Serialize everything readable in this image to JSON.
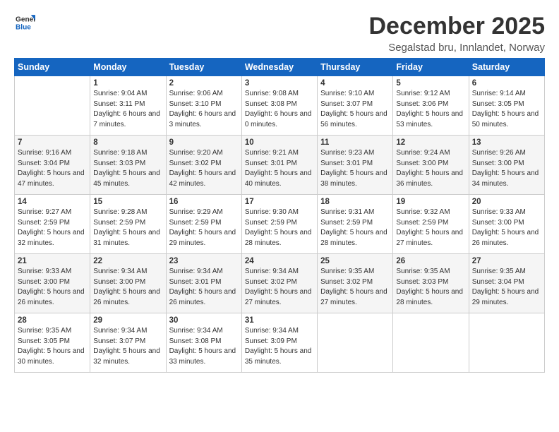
{
  "logo": {
    "line1": "General",
    "line2": "Blue"
  },
  "title": "December 2025",
  "subtitle": "Segalstad bru, Innlandet, Norway",
  "calendar": {
    "headers": [
      "Sunday",
      "Monday",
      "Tuesday",
      "Wednesday",
      "Thursday",
      "Friday",
      "Saturday"
    ],
    "weeks": [
      [
        {
          "day": "",
          "sunrise": "",
          "sunset": "",
          "daylight": ""
        },
        {
          "day": "1",
          "sunrise": "Sunrise: 9:04 AM",
          "sunset": "Sunset: 3:11 PM",
          "daylight": "Daylight: 6 hours and 7 minutes."
        },
        {
          "day": "2",
          "sunrise": "Sunrise: 9:06 AM",
          "sunset": "Sunset: 3:10 PM",
          "daylight": "Daylight: 6 hours and 3 minutes."
        },
        {
          "day": "3",
          "sunrise": "Sunrise: 9:08 AM",
          "sunset": "Sunset: 3:08 PM",
          "daylight": "Daylight: 6 hours and 0 minutes."
        },
        {
          "day": "4",
          "sunrise": "Sunrise: 9:10 AM",
          "sunset": "Sunset: 3:07 PM",
          "daylight": "Daylight: 5 hours and 56 minutes."
        },
        {
          "day": "5",
          "sunrise": "Sunrise: 9:12 AM",
          "sunset": "Sunset: 3:06 PM",
          "daylight": "Daylight: 5 hours and 53 minutes."
        },
        {
          "day": "6",
          "sunrise": "Sunrise: 9:14 AM",
          "sunset": "Sunset: 3:05 PM",
          "daylight": "Daylight: 5 hours and 50 minutes."
        }
      ],
      [
        {
          "day": "7",
          "sunrise": "Sunrise: 9:16 AM",
          "sunset": "Sunset: 3:04 PM",
          "daylight": "Daylight: 5 hours and 47 minutes."
        },
        {
          "day": "8",
          "sunrise": "Sunrise: 9:18 AM",
          "sunset": "Sunset: 3:03 PM",
          "daylight": "Daylight: 5 hours and 45 minutes."
        },
        {
          "day": "9",
          "sunrise": "Sunrise: 9:20 AM",
          "sunset": "Sunset: 3:02 PM",
          "daylight": "Daylight: 5 hours and 42 minutes."
        },
        {
          "day": "10",
          "sunrise": "Sunrise: 9:21 AM",
          "sunset": "Sunset: 3:01 PM",
          "daylight": "Daylight: 5 hours and 40 minutes."
        },
        {
          "day": "11",
          "sunrise": "Sunrise: 9:23 AM",
          "sunset": "Sunset: 3:01 PM",
          "daylight": "Daylight: 5 hours and 38 minutes."
        },
        {
          "day": "12",
          "sunrise": "Sunrise: 9:24 AM",
          "sunset": "Sunset: 3:00 PM",
          "daylight": "Daylight: 5 hours and 36 minutes."
        },
        {
          "day": "13",
          "sunrise": "Sunrise: 9:26 AM",
          "sunset": "Sunset: 3:00 PM",
          "daylight": "Daylight: 5 hours and 34 minutes."
        }
      ],
      [
        {
          "day": "14",
          "sunrise": "Sunrise: 9:27 AM",
          "sunset": "Sunset: 2:59 PM",
          "daylight": "Daylight: 5 hours and 32 minutes."
        },
        {
          "day": "15",
          "sunrise": "Sunrise: 9:28 AM",
          "sunset": "Sunset: 2:59 PM",
          "daylight": "Daylight: 5 hours and 31 minutes."
        },
        {
          "day": "16",
          "sunrise": "Sunrise: 9:29 AM",
          "sunset": "Sunset: 2:59 PM",
          "daylight": "Daylight: 5 hours and 29 minutes."
        },
        {
          "day": "17",
          "sunrise": "Sunrise: 9:30 AM",
          "sunset": "Sunset: 2:59 PM",
          "daylight": "Daylight: 5 hours and 28 minutes."
        },
        {
          "day": "18",
          "sunrise": "Sunrise: 9:31 AM",
          "sunset": "Sunset: 2:59 PM",
          "daylight": "Daylight: 5 hours and 28 minutes."
        },
        {
          "day": "19",
          "sunrise": "Sunrise: 9:32 AM",
          "sunset": "Sunset: 2:59 PM",
          "daylight": "Daylight: 5 hours and 27 minutes."
        },
        {
          "day": "20",
          "sunrise": "Sunrise: 9:33 AM",
          "sunset": "Sunset: 3:00 PM",
          "daylight": "Daylight: 5 hours and 26 minutes."
        }
      ],
      [
        {
          "day": "21",
          "sunrise": "Sunrise: 9:33 AM",
          "sunset": "Sunset: 3:00 PM",
          "daylight": "Daylight: 5 hours and 26 minutes."
        },
        {
          "day": "22",
          "sunrise": "Sunrise: 9:34 AM",
          "sunset": "Sunset: 3:00 PM",
          "daylight": "Daylight: 5 hours and 26 minutes."
        },
        {
          "day": "23",
          "sunrise": "Sunrise: 9:34 AM",
          "sunset": "Sunset: 3:01 PM",
          "daylight": "Daylight: 5 hours and 26 minutes."
        },
        {
          "day": "24",
          "sunrise": "Sunrise: 9:34 AM",
          "sunset": "Sunset: 3:02 PM",
          "daylight": "Daylight: 5 hours and 27 minutes."
        },
        {
          "day": "25",
          "sunrise": "Sunrise: 9:35 AM",
          "sunset": "Sunset: 3:02 PM",
          "daylight": "Daylight: 5 hours and 27 minutes."
        },
        {
          "day": "26",
          "sunrise": "Sunrise: 9:35 AM",
          "sunset": "Sunset: 3:03 PM",
          "daylight": "Daylight: 5 hours and 28 minutes."
        },
        {
          "day": "27",
          "sunrise": "Sunrise: 9:35 AM",
          "sunset": "Sunset: 3:04 PM",
          "daylight": "Daylight: 5 hours and 29 minutes."
        }
      ],
      [
        {
          "day": "28",
          "sunrise": "Sunrise: 9:35 AM",
          "sunset": "Sunset: 3:05 PM",
          "daylight": "Daylight: 5 hours and 30 minutes."
        },
        {
          "day": "29",
          "sunrise": "Sunrise: 9:34 AM",
          "sunset": "Sunset: 3:07 PM",
          "daylight": "Daylight: 5 hours and 32 minutes."
        },
        {
          "day": "30",
          "sunrise": "Sunrise: 9:34 AM",
          "sunset": "Sunset: 3:08 PM",
          "daylight": "Daylight: 5 hours and 33 minutes."
        },
        {
          "day": "31",
          "sunrise": "Sunrise: 9:34 AM",
          "sunset": "Sunset: 3:09 PM",
          "daylight": "Daylight: 5 hours and 35 minutes."
        },
        {
          "day": "",
          "sunrise": "",
          "sunset": "",
          "daylight": ""
        },
        {
          "day": "",
          "sunrise": "",
          "sunset": "",
          "daylight": ""
        },
        {
          "day": "",
          "sunrise": "",
          "sunset": "",
          "daylight": ""
        }
      ]
    ]
  }
}
